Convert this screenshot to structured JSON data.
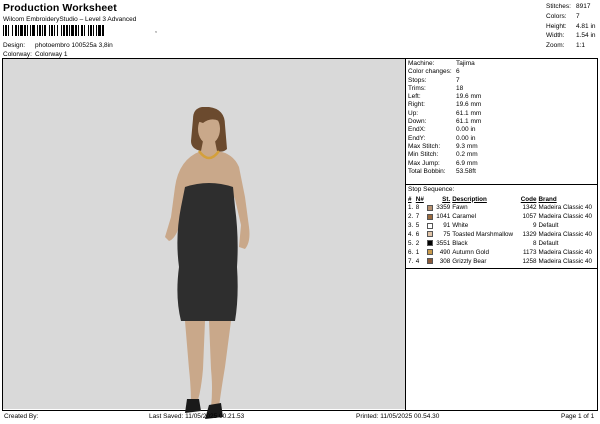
{
  "header": {
    "title": "Production Worksheet",
    "subtitle": "Wilcom EmbroideryStudio – Level 3 Advanced",
    "barcode_tail": ",",
    "design_label": "Design:",
    "design_value": "photoembro 100525a 3,8in",
    "colorway_label": "Colorway:",
    "colorway_value": "Colorway 1"
  },
  "summary": [
    {
      "label": "Stitches:",
      "value": "8917"
    },
    {
      "label": "Colors:",
      "value": "7"
    },
    {
      "label": "Height:",
      "value": "4.81 in"
    },
    {
      "label": "Width:",
      "value": "1.54 in"
    },
    {
      "label": "Zoom:",
      "value": "1:1"
    }
  ],
  "machine": [
    {
      "label": "Machine:",
      "value": "Tajima"
    },
    {
      "label": "Color changes:",
      "value": "6"
    },
    {
      "label": "Stops:",
      "value": "7"
    },
    {
      "label": "Trims:",
      "value": "18"
    },
    {
      "label": "Left:",
      "value": "19.6 mm"
    },
    {
      "label": "Right:",
      "value": "19.6 mm"
    },
    {
      "label": "Up:",
      "value": "61.1 mm"
    },
    {
      "label": "Down:",
      "value": "61.1 mm"
    },
    {
      "label": "EndX:",
      "value": "0.00 in"
    },
    {
      "label": "EndY:",
      "value": "0.00 in"
    },
    {
      "label": "Max Stitch:",
      "value": "9.3 mm"
    },
    {
      "label": "Min Stitch:",
      "value": "0.2 mm"
    },
    {
      "label": "Max Jump:",
      "value": "6.9 mm"
    },
    {
      "label": "Total Bobbin:",
      "value": "53.58ft"
    }
  ],
  "stop_sequence": {
    "title": "Stop Sequence:",
    "headers": {
      "num": "#",
      "n": "N#",
      "st": "St.",
      "description": "Description",
      "code": "Code",
      "brand": "Brand"
    },
    "rows": [
      {
        "num": "1.",
        "n": "8",
        "color": "#b89270",
        "st": "3359",
        "description": "Fawn",
        "code": "1342",
        "brand": "Madeira Classic 40"
      },
      {
        "num": "2.",
        "n": "7",
        "color": "#9a6a3e",
        "st": "1041",
        "description": "Caramel",
        "code": "1057",
        "brand": "Madeira Classic 40"
      },
      {
        "num": "3.",
        "n": "5",
        "color": "#ffffff",
        "st": "91",
        "description": "White",
        "code": "9",
        "brand": "Default"
      },
      {
        "num": "4.",
        "n": "6",
        "color": "#e0c4a8",
        "st": "75",
        "description": "Toasted Marshmallow",
        "code": "1329",
        "brand": "Madeira Classic 40"
      },
      {
        "num": "5.",
        "n": "2",
        "color": "#000000",
        "st": "3551",
        "description": "Black",
        "code": "8",
        "brand": "Default"
      },
      {
        "num": "6.",
        "n": "1",
        "color": "#c99a4b",
        "st": "490",
        "description": "Autumn Gold",
        "code": "1173",
        "brand": "Madeira Classic 40"
      },
      {
        "num": "7.",
        "n": "4",
        "color": "#8a5a3a",
        "st": "308",
        "description": "Grizzly Bear",
        "code": "1258",
        "brand": "Madeira Classic 40"
      }
    ]
  },
  "footer": {
    "created": "Created By:",
    "saved": "Last Saved: 11/05/2025 00.21.53",
    "printed": "Printed: 11/05/2025 00.54.30",
    "page": "Page 1 of 1"
  },
  "colors": {
    "canvas": "#d9d9d9",
    "dress": "#2e2e2e",
    "skin": "#c9a88a",
    "hair": "#6b4a2e",
    "necklace": "#d4a03a"
  }
}
